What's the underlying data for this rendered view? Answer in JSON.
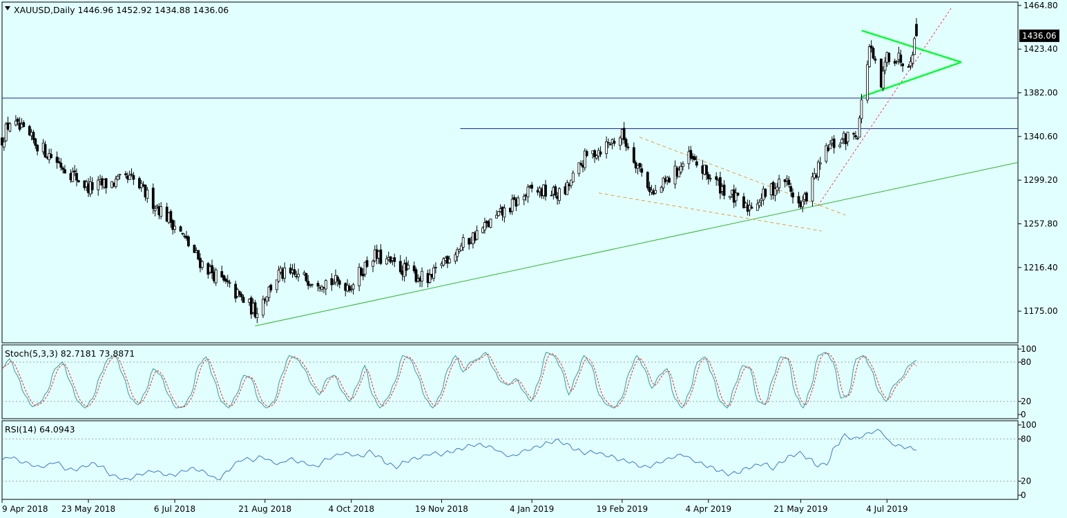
{
  "chart_data": [
    {
      "type": "candlestick",
      "symbol": "XAUUSD",
      "timeframe": "Daily",
      "title": "XAUUSD,Daily",
      "ohlc_header": {
        "open": "1446.96",
        "high": "1452.92",
        "low": "1434.88",
        "close": "1436.06"
      },
      "last_price_label": "1436.06",
      "ylim": [
        1145,
        1468
      ],
      "y_ticks": [
        "1464.80",
        "1423.40",
        "1382.00",
        "1340.60",
        "1299.20",
        "1257.80",
        "1216.40",
        "1175.00"
      ],
      "x_ticks": [
        "9 Apr 2018",
        "23 May 2018",
        "6 Jul 2018",
        "21 Aug 2018",
        "4 Oct 2018",
        "19 Nov 2018",
        "4 Jan 2019",
        "19 Feb 2019",
        "4 Apr 2019",
        "21 May 2019",
        "4 Jul 2019"
      ],
      "key_points": [
        {
          "date": "9 Apr 2018",
          "close": 1338
        },
        {
          "date": "13 Apr 2018",
          "close": 1355
        },
        {
          "date": "23 May 2018",
          "close": 1292
        },
        {
          "date": "14 Jun 2018",
          "close": 1300
        },
        {
          "date": "6 Jul 2018",
          "close": 1257
        },
        {
          "date": "19 Jul 2018",
          "close": 1222
        },
        {
          "date": "16 Aug 2018",
          "close": 1175
        },
        {
          "date": "28 Aug 2018",
          "close": 1210
        },
        {
          "date": "4 Oct 2018",
          "close": 1200
        },
        {
          "date": "15 Oct 2018",
          "close": 1228
        },
        {
          "date": "13 Nov 2018",
          "close": 1203
        },
        {
          "date": "19 Nov 2018",
          "close": 1222
        },
        {
          "date": "4 Jan 2019",
          "close": 1290
        },
        {
          "date": "20 Jan 2019",
          "close": 1285
        },
        {
          "date": "31 Jan 2019",
          "close": 1320
        },
        {
          "date": "19 Feb 2019",
          "close": 1342
        },
        {
          "date": "7 Mar 2019",
          "close": 1285
        },
        {
          "date": "25 Mar 2019",
          "close": 1320
        },
        {
          "date": "23 Apr 2019",
          "close": 1272
        },
        {
          "date": "13 May 2019",
          "close": 1300
        },
        {
          "date": "21 May 2019",
          "close": 1273
        },
        {
          "date": "4 Jun 2019",
          "close": 1330
        },
        {
          "date": "19 Jun 2019",
          "close": 1345
        },
        {
          "date": "25 Jun 2019",
          "close": 1425
        },
        {
          "date": "1 Jul 2019",
          "close": 1388
        },
        {
          "date": "4 Jul 2019",
          "close": 1418
        },
        {
          "date": "15 Jul 2019",
          "close": 1412
        },
        {
          "date": "19 Jul 2019",
          "close": 1436.06
        }
      ],
      "horizontal_levels": [
        1377,
        1348
      ],
      "colors": {
        "background": "#e2ffff",
        "candles": "#000000",
        "uptrend_line": "#2db52d",
        "wedge_lines": "#e89b3c",
        "triangle": "#00ff33",
        "dotted_trend": "#ff3355",
        "levels": "#1a2b8a"
      }
    },
    {
      "type": "line",
      "indicator": "Stochastic",
      "title": "Stoch(5,3,3) 82.7181 73.8871",
      "ylim": [
        0,
        100
      ],
      "y_ticks": [
        "100",
        "80",
        "20",
        "0"
      ],
      "series": [
        {
          "name": "%K",
          "color": "#2a9fa0",
          "style": "solid",
          "last_value": 82.7181
        },
        {
          "name": "%D",
          "color": "#ff2020",
          "style": "dashed",
          "last_value": 73.8871
        }
      ],
      "oscillation_values": [
        70,
        85,
        60,
        30,
        12,
        18,
        35,
        70,
        80,
        50,
        20,
        10,
        25,
        60,
        85,
        90,
        60,
        25,
        15,
        35,
        70,
        60,
        30,
        10,
        12,
        30,
        75,
        88,
        55,
        20,
        10,
        30,
        60,
        55,
        20,
        10,
        20,
        60,
        90,
        85,
        70,
        45,
        30,
        55,
        60,
        35,
        20,
        45,
        75,
        30,
        10,
        25,
        50,
        90,
        85,
        60,
        25,
        10,
        30,
        70,
        90,
        65,
        80,
        85,
        95,
        70,
        50,
        45,
        55,
        35,
        20,
        50,
        95,
        90,
        70,
        30,
        60,
        90,
        75,
        30,
        15,
        10,
        25,
        65,
        90,
        70,
        40,
        60,
        70,
        25,
        10,
        35,
        80,
        88,
        60,
        20,
        10,
        45,
        75,
        70,
        20,
        15,
        55,
        88,
        85,
        30,
        10,
        40,
        90,
        95,
        80,
        25,
        30,
        85,
        90,
        70,
        35,
        20,
        45,
        55,
        75,
        82.7
      ]
    },
    {
      "type": "line",
      "indicator": "RSI",
      "title": "RSI(14) 64.0943",
      "ylim": [
        0,
        100
      ],
      "y_ticks": [
        "100",
        "80",
        "20",
        "0"
      ],
      "series": [
        {
          "name": "RSI",
          "color": "#3c78c8",
          "last_value": 64.0943
        }
      ],
      "values": [
        50,
        55,
        48,
        45,
        40,
        42,
        48,
        38,
        36,
        40,
        45,
        42,
        30,
        25,
        22,
        28,
        32,
        35,
        30,
        28,
        33,
        38,
        36,
        30,
        22,
        32,
        45,
        52,
        50,
        55,
        48,
        44,
        52,
        48,
        45,
        40,
        50,
        55,
        60,
        58,
        55,
        62,
        55,
        45,
        40,
        48,
        52,
        55,
        60,
        58,
        62,
        65,
        70,
        72,
        70,
        66,
        58,
        55,
        62,
        66,
        70,
        75,
        78,
        72,
        65,
        60,
        62,
        58,
        55,
        50,
        48,
        42,
        40,
        45,
        50,
        55,
        58,
        50,
        45,
        40,
        35,
        30,
        32,
        38,
        42,
        45,
        38,
        48,
        56,
        60,
        52,
        42,
        45,
        70,
        85,
        80,
        84,
        90,
        92,
        75,
        70,
        68,
        64.1
      ]
    }
  ]
}
